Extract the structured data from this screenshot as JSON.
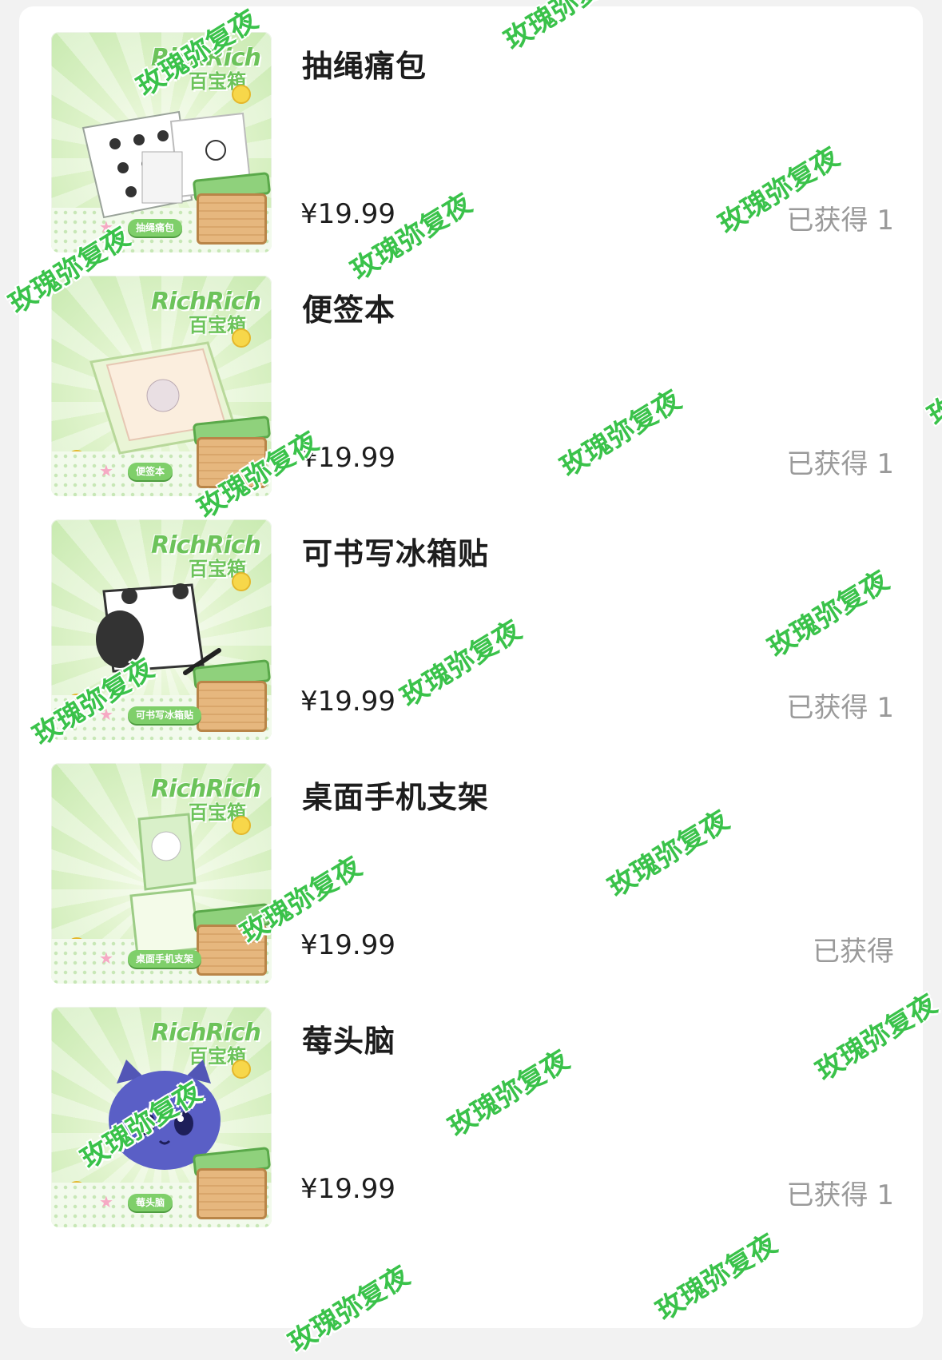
{
  "colors": {
    "page_background": "#f2f2f2",
    "card_background": "#ffffff",
    "text_primary": "#1d1d1d",
    "text_secondary": "#9a9a9a",
    "watermark": "#3ac24a",
    "thumb_accent": "#6cc35a"
  },
  "thumbnail_brand": {
    "top": "RichRich",
    "bottom": "百宝箱"
  },
  "items": [
    {
      "name": "抽绳痛包",
      "price": "¥19.99",
      "owned": "已获得 1",
      "thumb_tag": "抽绳痛包",
      "thumb_icon": "drawstring-bag-icon"
    },
    {
      "name": "便签本",
      "price": "¥19.99",
      "owned": "已获得 1",
      "thumb_tag": "便签本",
      "thumb_icon": "notepad-icon"
    },
    {
      "name": "可书写冰箱贴",
      "price": "¥19.99",
      "owned": "已获得 1",
      "thumb_tag": "可书写冰箱贴",
      "thumb_icon": "fridge-magnet-icon"
    },
    {
      "name": "桌面手机支架",
      "price": "¥19.99",
      "owned": "已获得",
      "thumb_tag": "桌面手机支架",
      "thumb_icon": "phone-stand-icon"
    },
    {
      "name": "莓头脑",
      "price": "¥19.99",
      "owned": "已获得 1",
      "thumb_tag": "莓头脑",
      "thumb_icon": "plush-toy-icon"
    }
  ],
  "watermark_text": "玫瑰弥复夜"
}
